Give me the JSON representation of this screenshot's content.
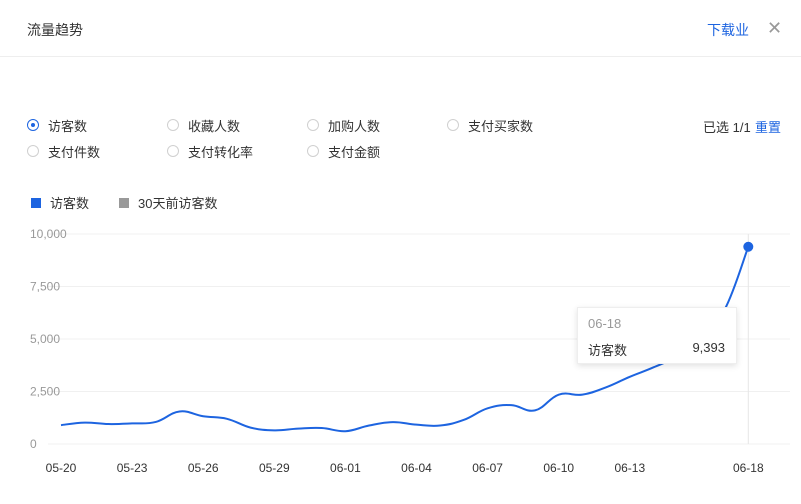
{
  "header": {
    "title": "流量趋势",
    "download_label": "下载业",
    "close_label": "✕"
  },
  "metrics": [
    {
      "label": "访客数",
      "checked": true
    },
    {
      "label": "收藏人数",
      "checked": false
    },
    {
      "label": "加购人数",
      "checked": false
    },
    {
      "label": "支付买家数",
      "checked": false
    },
    {
      "label": "支付件数",
      "checked": false
    },
    {
      "label": "支付转化率",
      "checked": false
    },
    {
      "label": "支付金额",
      "checked": false
    }
  ],
  "selection": {
    "info": "已选 1/1",
    "reset_label": "重置"
  },
  "legend": [
    {
      "label": "访客数",
      "color": "#1d64e0"
    },
    {
      "label": "30天前访客数",
      "color": "#999999"
    }
  ],
  "tooltip": {
    "date": "06-18",
    "series": "访客数",
    "value": "9,393"
  },
  "chart_data": {
    "type": "line",
    "y_tick_labels": [
      "0",
      "2,500",
      "5,000",
      "7,500",
      "10,000"
    ],
    "ylim": [
      0,
      10000
    ],
    "x_tick_labels": [
      "05-20",
      "05-23",
      "05-26",
      "05-29",
      "06-01",
      "06-04",
      "06-07",
      "06-10",
      "06-13",
      "06-18"
    ],
    "x": [
      "05-20",
      "05-21",
      "05-22",
      "05-23",
      "05-24",
      "05-25",
      "05-26",
      "05-27",
      "05-28",
      "05-29",
      "05-30",
      "05-31",
      "06-01",
      "06-02",
      "06-03",
      "06-04",
      "06-05",
      "06-06",
      "06-07",
      "06-08",
      "06-09",
      "06-10",
      "06-11",
      "06-12",
      "06-13",
      "06-14",
      "06-15",
      "06-16",
      "06-17",
      "06-18"
    ],
    "series": [
      {
        "name": "访客数",
        "color": "#1d64e0",
        "values": [
          900,
          1020,
          950,
          980,
          1050,
          1550,
          1320,
          1200,
          780,
          650,
          730,
          760,
          610,
          880,
          1040,
          920,
          880,
          1150,
          1700,
          1850,
          1600,
          2350,
          2350,
          2700,
          3200,
          3650,
          4200,
          5200,
          6400,
          9393
        ]
      }
    ],
    "grid": true,
    "highlight_index": 29
  }
}
